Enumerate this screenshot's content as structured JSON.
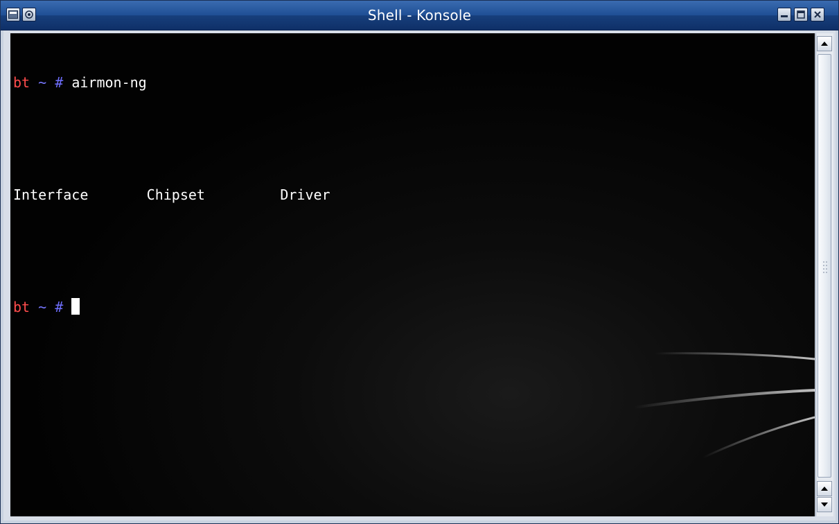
{
  "window": {
    "title": "Shell - Konsole",
    "colors": {
      "titlebar": "#1f4f95",
      "terminal_bg": "#000000",
      "prompt_host": "#ff4c4c",
      "prompt_symbol": "#6f6fff",
      "text": "#ffffff"
    },
    "titlebar_buttons_left": [
      "window-menu-icon",
      "sticky-pin-icon"
    ],
    "titlebar_buttons_right": [
      "minimize-icon",
      "maximize-icon",
      "close-icon"
    ]
  },
  "terminal": {
    "line1": {
      "host": "bt",
      "tilde": "~",
      "hash": "#",
      "command": "airmon-ng"
    },
    "header": {
      "col1": "Interface",
      "col2": "Chipset",
      "col3": "Driver"
    },
    "line3": {
      "host": "bt",
      "tilde": "~",
      "hash": "#"
    }
  }
}
